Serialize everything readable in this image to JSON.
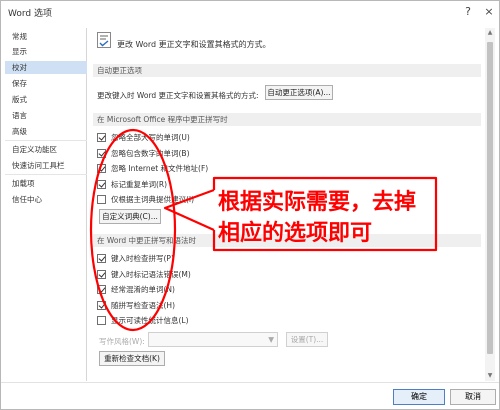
{
  "window": {
    "title": "Word 选项",
    "help_icon": "?",
    "close_icon": "×"
  },
  "sidebar": {
    "items": [
      {
        "label": "常规"
      },
      {
        "label": "显示"
      },
      {
        "label": "校对"
      },
      {
        "label": "保存"
      },
      {
        "label": "版式"
      },
      {
        "label": "语言"
      },
      {
        "label": "高级"
      },
      {
        "label": "自定义功能区"
      },
      {
        "label": "快速访问工具栏"
      },
      {
        "label": "加载项"
      },
      {
        "label": "信任中心"
      }
    ],
    "active": "校对"
  },
  "header": {
    "text": "更改 Word 更正文字和设置其格式的方式。"
  },
  "autocorrect_section": {
    "title": "自动更正选项",
    "label": "更改键入时 Word 更正文字和设置其格式的方式:",
    "button": "自动更正选项(A)..."
  },
  "office_section": {
    "title": "在 Microsoft Office 程序中更正拼写时",
    "options": [
      {
        "label": "忽略全部大写的单词(U)",
        "checked": true
      },
      {
        "label": "忽略包含数字的单词(B)",
        "checked": true
      },
      {
        "label": "忽略 Internet 和文件地址(F)",
        "checked": true
      },
      {
        "label": "标记重复单词(R)",
        "checked": true
      },
      {
        "label": "仅根据主词典提供建议(I)",
        "checked": false
      }
    ],
    "custom_dict_button": "自定义词典(C)..."
  },
  "word_section": {
    "title": "在 Word 中更正拼写和语法时",
    "options": [
      {
        "label": "键入时检查拼写(P)",
        "checked": true
      },
      {
        "label": "键入时标记语法错误(M)",
        "checked": true
      },
      {
        "label": "经常混淆的单词(N)",
        "checked": true
      },
      {
        "label": "随拼写检查语法(H)",
        "checked": true
      },
      {
        "label": "显示可读性统计信息(L)",
        "checked": false
      }
    ],
    "style_label": "写作风格(W):",
    "settings_button": "设置(T)...",
    "recheck_button": "重新检查文档(K)"
  },
  "footer": {
    "ok": "确定",
    "cancel": "取消"
  },
  "annotation": {
    "text": "根据实际需要，去掉相应的选项即可",
    "color": "#ff0000"
  },
  "colors": {
    "active_item": "#cfe0f4",
    "section_bar": "#efefef",
    "ok_border": "#4d7fc2"
  }
}
